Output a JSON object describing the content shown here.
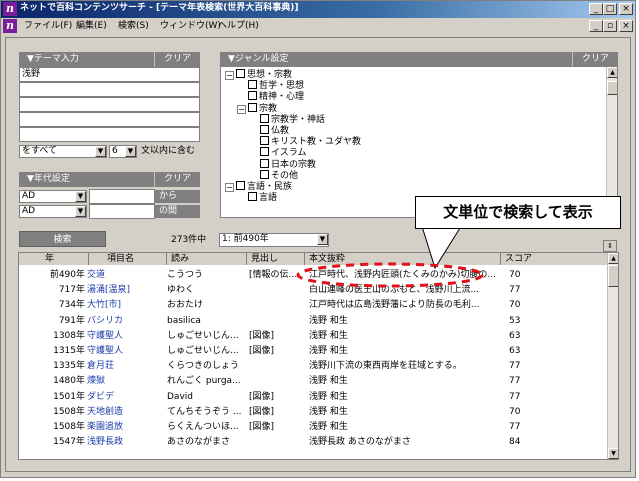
{
  "window": {
    "title": "ネットで百科コンテンツサーチ - [テーマ年表検索(世界大百科事典)]",
    "app_icon_glyph": "n",
    "caption_buttons": [
      "_",
      "□",
      "×"
    ],
    "mdi_buttons": [
      "_",
      "▫",
      "×"
    ]
  },
  "menu": [
    "ファイル(F)",
    "編集(E)",
    "検索(S)",
    "ウィンドウ(W)",
    "ヘルプ(H)"
  ],
  "theme_input": {
    "header": "▼テーマ入力",
    "clear": "クリア",
    "fields": [
      "浅野",
      "",
      "",
      "",
      ""
    ],
    "mode": "をすべて",
    "within": "6",
    "within_suffix": "文以内に含む"
  },
  "era": {
    "header": "▼年代設定",
    "clear": "クリア",
    "from_era": "AD",
    "to_era": "AD",
    "from_label": "から",
    "to_label": "の間"
  },
  "genre": {
    "header": "▼ジャンル設定",
    "clear": "クリア",
    "items": [
      {
        "label": "思想・宗教",
        "level": 0,
        "exp": "−"
      },
      {
        "label": "哲学・思想",
        "level": 1,
        "exp": ""
      },
      {
        "label": "精神・心理",
        "level": 1,
        "exp": ""
      },
      {
        "label": "宗教",
        "level": 1,
        "exp": "−"
      },
      {
        "label": "宗教学・神話",
        "level": 2,
        "exp": ""
      },
      {
        "label": "仏教",
        "level": 2,
        "exp": ""
      },
      {
        "label": "キリスト教・ユダヤ教",
        "level": 2,
        "exp": ""
      },
      {
        "label": "イスラム",
        "level": 2,
        "exp": ""
      },
      {
        "label": "日本の宗教",
        "level": 2,
        "exp": ""
      },
      {
        "label": "その他",
        "level": 2,
        "exp": ""
      },
      {
        "label": "言語・民族",
        "level": 0,
        "exp": "−"
      },
      {
        "label": "言語",
        "level": 1,
        "exp": ""
      }
    ]
  },
  "search": {
    "button": "検索",
    "count_text": "273件中",
    "position": "1: 前490年"
  },
  "callout": "文単位で検索して表示",
  "results": {
    "columns": [
      "年",
      "項目名",
      "読み",
      "見出し",
      "本文抜粋",
      "スコア"
    ],
    "rows": [
      {
        "year": "前490年",
        "item": "交道",
        "reading": "こうつう",
        "heading": "[情報の伝...",
        "excerpt": "江戸時代、浅野内匠頭(たくみのかみ)切腹の...",
        "score": "70"
      },
      {
        "year": "717年",
        "item": "湯涌[温泉]",
        "reading": "ゆわく",
        "heading": "",
        "excerpt": "白山連峰の医王山のふもと、浅野川上流...",
        "score": "77"
      },
      {
        "year": "734年",
        "item": "大竹[市]",
        "reading": "おおたけ",
        "heading": "",
        "excerpt": "江戸時代は広島浅野藩により防長の毛利...",
        "score": "70"
      },
      {
        "year": "791年",
        "item": "バシリカ",
        "reading": "basilica",
        "heading": "",
        "excerpt": "浅野 和生",
        "score": "53"
      },
      {
        "year": "1308年",
        "item": "守護聖人",
        "reading": "しゅごせいじん...",
        "heading": "[図像]",
        "excerpt": "浅野 和生",
        "score": "63"
      },
      {
        "year": "1315年",
        "item": "守護聖人",
        "reading": "しゅごせいじん...",
        "heading": "[図像]",
        "excerpt": "浅野 和生",
        "score": "63"
      },
      {
        "year": "1335年",
        "item": "倉月荘",
        "reading": "くらつきのしょう",
        "heading": "",
        "excerpt": "浅野川下流の東西両岸を荘域とする。",
        "score": "77"
      },
      {
        "year": "1480年",
        "item": "煉獄",
        "reading": "れんごく purga...",
        "heading": "",
        "excerpt": "浅野 和生",
        "score": "77"
      },
      {
        "year": "1501年",
        "item": "ダビデ",
        "reading": "David",
        "heading": "[図像]",
        "excerpt": "浅野 和生",
        "score": "77"
      },
      {
        "year": "1508年",
        "item": "天地創造",
        "reading": "てんちそうぞう ...",
        "heading": "[図像]",
        "excerpt": "浅野 和生",
        "score": "70"
      },
      {
        "year": "1508年",
        "item": "楽園追放",
        "reading": "らくえんついほ...",
        "heading": "[図像]",
        "excerpt": "浅野 和生",
        "score": "77"
      },
      {
        "year": "1547年",
        "item": "浅野長政",
        "reading": "あさのながまさ",
        "heading": "",
        "excerpt": "浅野長政 あさのながまさ",
        "score": "84"
      }
    ]
  },
  "colors": {
    "panel_header": "#808080",
    "link": "#1a3aa8",
    "callout_dash": "#e0101a",
    "title_gradient_start": "#0a246a"
  }
}
